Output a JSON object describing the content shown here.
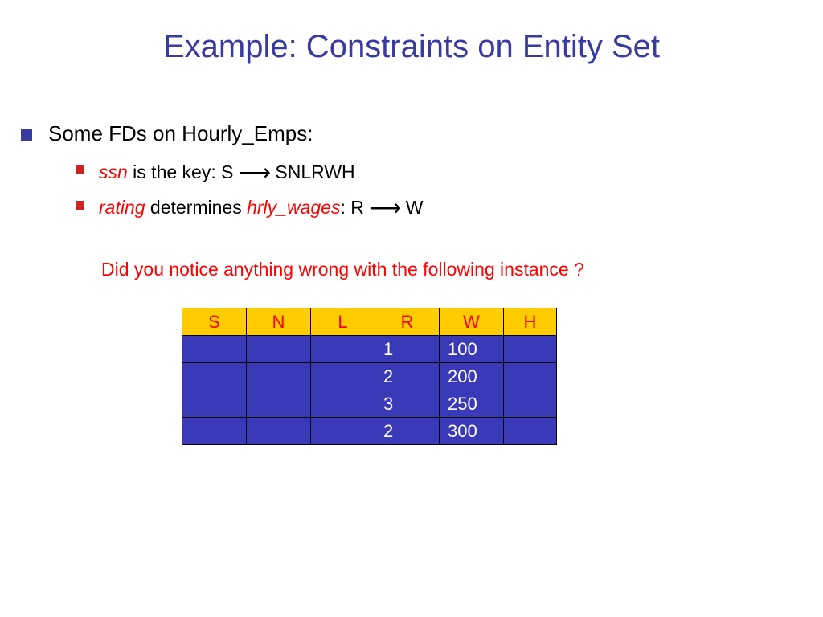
{
  "title": "Example:  Constraints on Entity Set",
  "bullets": {
    "l1": "Some FDs on Hourly_Emps:",
    "l2a_term": "ssn",
    "l2a_rest": " is the key:    S ",
    "l2a_after": "  SNLRWH",
    "l2b_term1": "rating",
    "l2b_mid": " determines ",
    "l2b_term2": "hrly_wages",
    "l2b_rest": ":    R ",
    "l2b_after": " W"
  },
  "question": "Did you notice anything wrong with the following instance ?",
  "chart_data": {
    "type": "table",
    "title": "",
    "columns": [
      "S",
      "N",
      "L",
      "R",
      "W",
      "H"
    ],
    "rows": [
      {
        "S": "",
        "N": "",
        "L": "",
        "R": "1",
        "W": "100",
        "H": ""
      },
      {
        "S": "",
        "N": "",
        "L": "",
        "R": "2",
        "W": "200",
        "H": ""
      },
      {
        "S": "",
        "N": "",
        "L": "",
        "R": "3",
        "W": "250",
        "H": ""
      },
      {
        "S": "",
        "N": "",
        "L": "",
        "R": "2",
        "W": "300",
        "H": ""
      }
    ]
  }
}
